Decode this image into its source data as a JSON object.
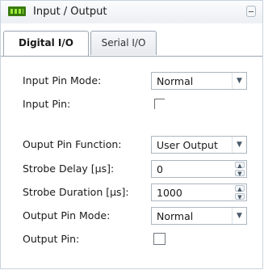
{
  "panel": {
    "title": "Input / Output",
    "title_icon": "io-board-icon",
    "collapse_icon": "collapse-icon"
  },
  "tabs": [
    {
      "label": "Digital I/O",
      "active": true
    },
    {
      "label": "Serial I/O",
      "active": false
    }
  ],
  "form": {
    "input_pin_mode": {
      "label": "Input Pin Mode:",
      "value": "Normal"
    },
    "input_pin": {
      "label": "Input Pin:",
      "checked": false
    },
    "output_pin_function": {
      "label": "Ouput Pin Function:",
      "value": "User Output"
    },
    "strobe_delay": {
      "label": "Strobe Delay [µs]:",
      "value": "0"
    },
    "strobe_duration": {
      "label": "Strobe Duration [µs]:",
      "value": "1000"
    },
    "output_pin_mode": {
      "label": "Output Pin Mode:",
      "value": "Normal"
    },
    "output_pin": {
      "label": "Output Pin:",
      "checked": false
    }
  },
  "colors": {
    "border": "#9aa6b3",
    "icon_green": "#3a7a10"
  }
}
